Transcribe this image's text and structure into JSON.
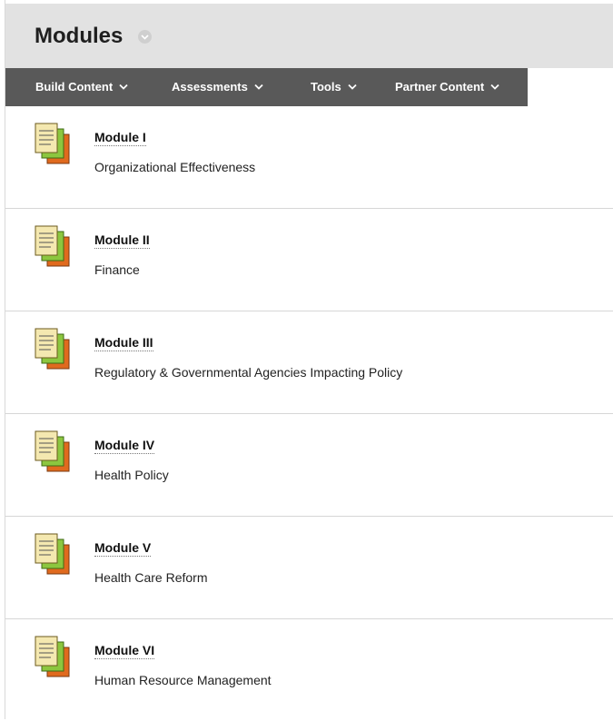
{
  "page": {
    "title": "Modules",
    "title_menu_icon": "chevron-down-icon"
  },
  "toolbar": {
    "items": [
      {
        "label": "Build Content"
      },
      {
        "label": "Assessments"
      },
      {
        "label": "Tools"
      },
      {
        "label": "Partner Content"
      }
    ],
    "background": "#595959"
  },
  "content": {
    "items": [
      {
        "title": "Module I",
        "description": "Organizational Effectiveness",
        "icon": "content-folder-icon"
      },
      {
        "title": "Module II",
        "description": "Finance",
        "icon": "content-folder-icon"
      },
      {
        "title": "Module III",
        "description": "Regulatory & Governmental Agencies Impacting Policy",
        "icon": "content-folder-icon"
      },
      {
        "title": "Module IV",
        "description": "Health Policy",
        "icon": "content-folder-icon"
      },
      {
        "title": "Module V",
        "description": "Health Care Reform",
        "icon": "content-folder-icon"
      },
      {
        "title": "Module VI",
        "description": "Human Resource Management",
        "icon": "content-folder-icon"
      }
    ]
  }
}
